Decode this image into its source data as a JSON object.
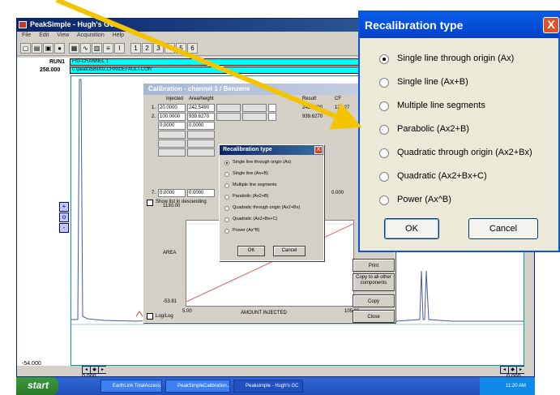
{
  "app": {
    "title": "PeakSimple - Hugh's GC",
    "menu": [
      "File",
      "Edit",
      "View",
      "Acquisition",
      "Help"
    ],
    "toolbar_numbers": [
      "1",
      "2",
      "3",
      "4",
      "5",
      "6"
    ],
    "run_label": "RUN1",
    "run_channel": "FID-CHANNEL 1",
    "run_path": "c:\\peak358\\002.CHN\\DEFAULT.CON",
    "y_max": "258.000",
    "y_min": "-54.000",
    "x_left": "0.000",
    "x_right": "0.000"
  },
  "calibration": {
    "title": "Calibration - channel 1 / Benzene",
    "headers": {
      "injected": "Injected",
      "area": "Area/height",
      "result": "Result",
      "cf": "CF"
    },
    "rows": [
      {
        "num": "1.",
        "injected": "20.0000",
        "area": "242.5490",
        "result": "242.5490",
        "cf": "12.127"
      },
      {
        "num": "2.",
        "injected": "100.0000",
        "area": "939.6270",
        "result": "939.6270",
        "cf": "9.396"
      }
    ],
    "blank_value": "0.0000",
    "row7_num": "7.",
    "row7_injected": "0.0000",
    "row7_area": "0.0000",
    "row7_result": "0.000",
    "show_list_label": "Show list in descending",
    "plot_y_max": "1130.00",
    "plot_y_min": "-53.81",
    "plot_x_min": "5.00",
    "plot_x_max": "105.00",
    "plot_ylabel": "AREA",
    "plot_xlabel": "AMOUNT INJECTED",
    "loglog_label": "Log/Log",
    "buttons": {
      "print": "Print",
      "copy_all": "Copy to all other components",
      "copy": "Copy",
      "close": "Close"
    }
  },
  "recal_dialog": {
    "title": "Recalibration type",
    "options": [
      "Single line through origin (Ax)",
      "Single line (Ax+B)",
      "Multiple line segments",
      "Parabolic (Ax2+B)",
      "Quadratic through origin (Ax2+Bx)",
      "Quadratic (Ax2+Bx+C)",
      "Power (Ax^B)"
    ],
    "selected_index": 0,
    "ok_label": "OK",
    "cancel_label": "Cancel",
    "close_glyph": "X"
  },
  "taskbar": {
    "start_label": "start",
    "tasks": [
      "EarthLink TotalAccess...",
      "PeakSimpleCalibration...",
      "Peaksimple - Hugh's GC"
    ],
    "clock": "11:20 AM"
  },
  "colors": {
    "arrow": "#f5c400",
    "xp_title": "#0a5de8",
    "run_field": "#00ffff",
    "trace": "#4a5a9a"
  }
}
